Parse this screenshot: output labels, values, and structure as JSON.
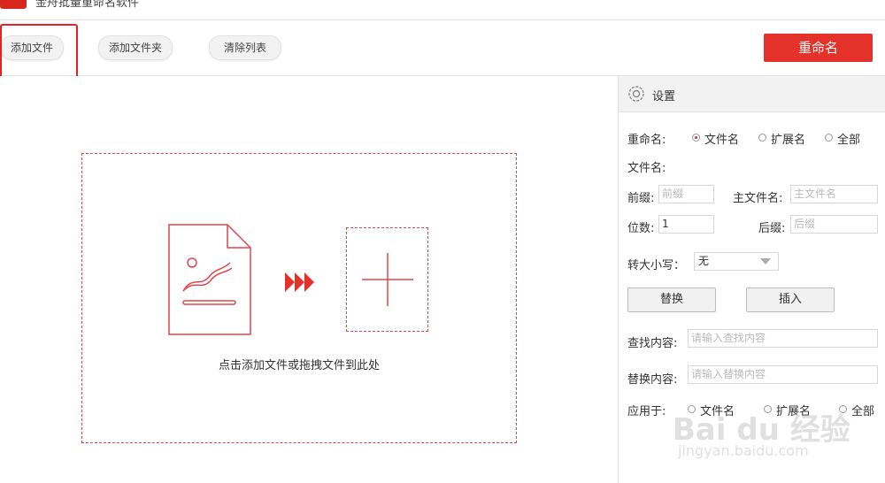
{
  "app": {
    "title": "金舟批量重命名软件"
  },
  "toolbar": {
    "add_file": "添加文件",
    "add_folder": "添加文件夹",
    "clear_list": "清除列表",
    "rename": "重命名"
  },
  "dropzone": {
    "hint": "点击添加文件或拖拽文件到此处"
  },
  "settings": {
    "title": "设置",
    "rename_label": "重命名:",
    "rename_options": [
      "文件名",
      "扩展名",
      "全部"
    ],
    "rename_selected": "文件名",
    "filename_label": "文件名:",
    "prefix_label": "前缀:",
    "prefix_placeholder": "前缀",
    "mainname_label": "主文件名:",
    "mainname_placeholder": "主文件名",
    "digits_label": "位数:",
    "digits_value": "1",
    "suffix_label": "后缀:",
    "suffix_placeholder": "后缀",
    "case_label": "转大小写：",
    "case_value": "无",
    "replace_button": "替换",
    "insert_button": "插入",
    "find_label": "查找内容:",
    "find_placeholder": "请输入查找内容",
    "replace_label": "替换内容:",
    "replace_placeholder": "请输入替换内容",
    "apply_label": "应用于:",
    "apply_options": [
      "文件名",
      "扩展名",
      "全部"
    ]
  },
  "watermark": {
    "line1": "Bai du 经验",
    "line2": "jingyan.baidu.com"
  },
  "colors": {
    "accent": "#e4312a",
    "annotation": "#e82020"
  }
}
